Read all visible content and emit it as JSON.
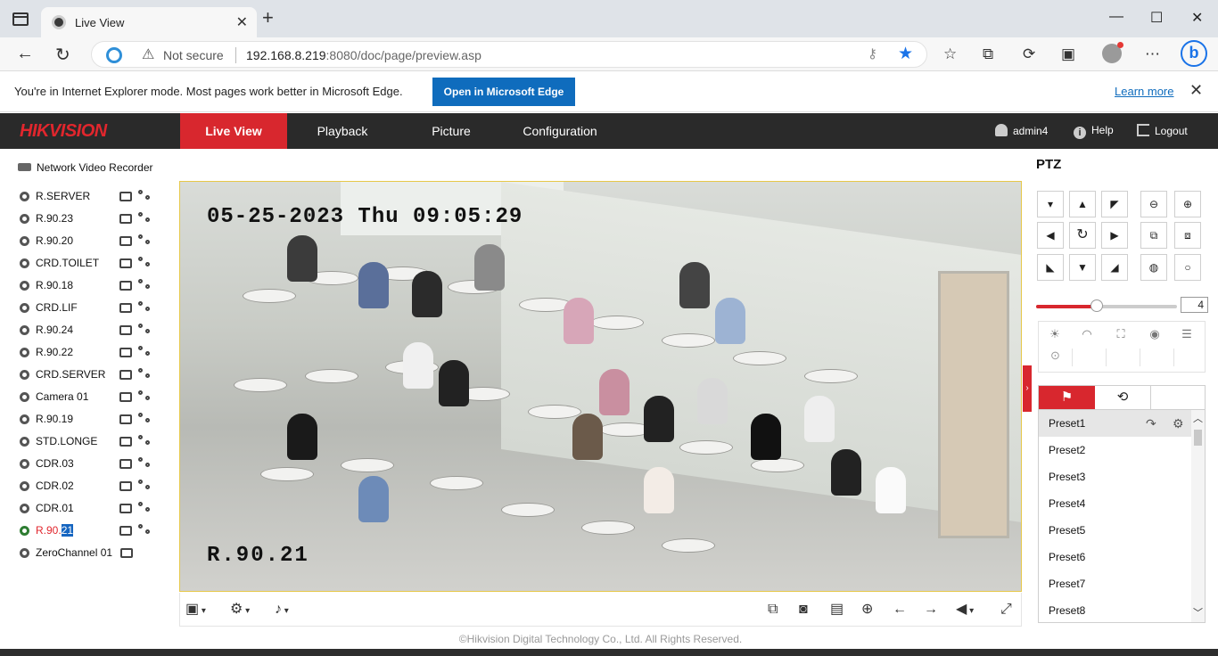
{
  "browser": {
    "tab_title": "Live View",
    "url_prefix": "192.168.8.219",
    "url_suffix": ":8080/doc/page/preview.asp",
    "security_label": "Not secure"
  },
  "ie_banner": {
    "message": "You're in Internet Explorer mode. Most pages work better in Microsoft Edge.",
    "open_button": "Open in Microsoft Edge",
    "learn_more": "Learn more"
  },
  "app": {
    "logo": "HIKVISION",
    "nav": [
      "Live View",
      "Playback",
      "Picture",
      "Configuration"
    ],
    "active_nav": "Live View",
    "user": "admin4",
    "help": "Help",
    "logout": "Logout"
  },
  "tree": {
    "root": "Network Video Recorder",
    "cameras": [
      {
        "name": "R.SERVER"
      },
      {
        "name": "R.90.23"
      },
      {
        "name": "R.90.20"
      },
      {
        "name": "CRD.TOILET"
      },
      {
        "name": "R.90.18"
      },
      {
        "name": "CRD.LIF"
      },
      {
        "name": "R.90.24"
      },
      {
        "name": "R.90.22"
      },
      {
        "name": "CRD.SERVER"
      },
      {
        "name": "Camera 01"
      },
      {
        "name": "R.90.19"
      },
      {
        "name": "STD.LONGE"
      },
      {
        "name": "CDR.03"
      },
      {
        "name": "CDR.02"
      },
      {
        "name": "CDR.01"
      }
    ],
    "active_camera_prefix": "R.90.",
    "active_camera_selected": "21",
    "zero_channel": "ZeroChannel 01"
  },
  "video": {
    "osd_timestamp": "05-25-2023 Thu 09:05:29",
    "osd_channel": "R.90.21"
  },
  "footer": "©Hikvision Digital Technology Co., Ltd. All Rights Reserved.",
  "ptz": {
    "title": "PTZ",
    "speed": "4",
    "speed_fraction": 0.43,
    "presets": [
      "Preset1",
      "Preset2",
      "Preset3",
      "Preset4",
      "Preset5",
      "Preset6",
      "Preset7",
      "Preset8"
    ],
    "selected_preset": "Preset1"
  },
  "colors": {
    "brand_red": "#d8272e",
    "header_bg": "#2a2a2a",
    "edge_blue": "#0f6cbd"
  }
}
